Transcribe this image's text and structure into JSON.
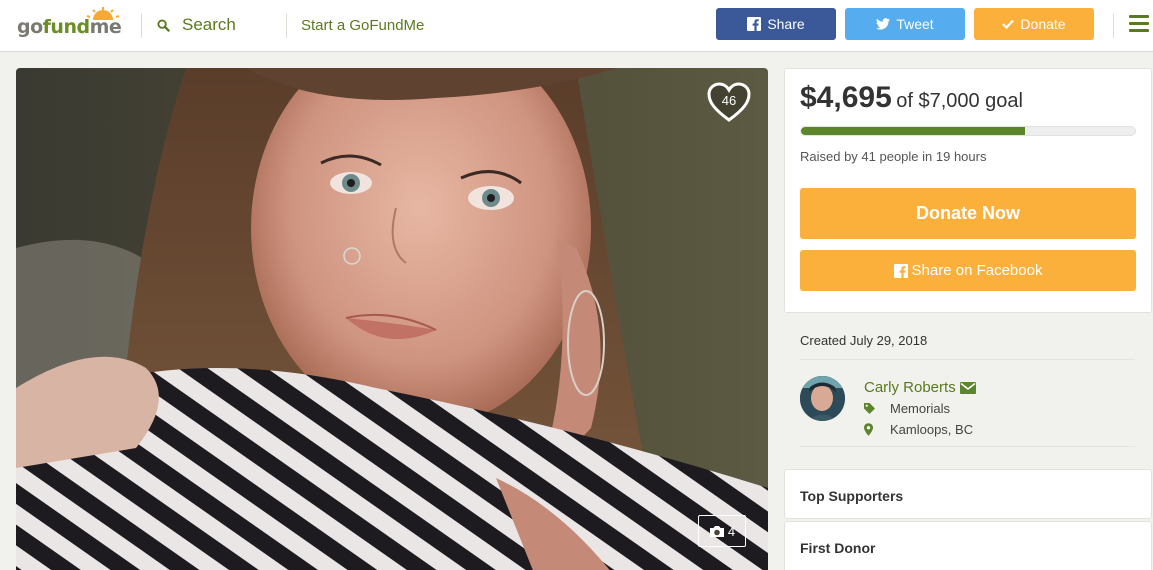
{
  "header": {
    "logo_text": {
      "go": "go",
      "fund": "fund",
      "me": "me"
    },
    "search_label": "Search",
    "start_label": "Start a GoFundMe",
    "share_label": "Share",
    "tweet_label": "Tweet",
    "donate_label": "Donate",
    "colors": {
      "facebook": "#3b5998",
      "twitter": "#55acee",
      "donate": "#fbb03b",
      "brand_green": "#5a7a1e"
    }
  },
  "photo": {
    "heart_count": "46",
    "photo_count": "4"
  },
  "campaign": {
    "raised_amount": "$4,695",
    "goal_text": "of $7,000 goal",
    "progress_fraction": 0.67,
    "raised_by": "Raised by 41 people in 19 hours",
    "donate_now_label": "Donate Now",
    "share_facebook_label": "Share on Facebook",
    "created": "Created July 29, 2018",
    "organizer_name": "Carly Roberts",
    "category": "Memorials",
    "location": "Kamloops, BC"
  },
  "sections": {
    "top_supporters": "Top Supporters",
    "first_donor": "First Donor"
  }
}
